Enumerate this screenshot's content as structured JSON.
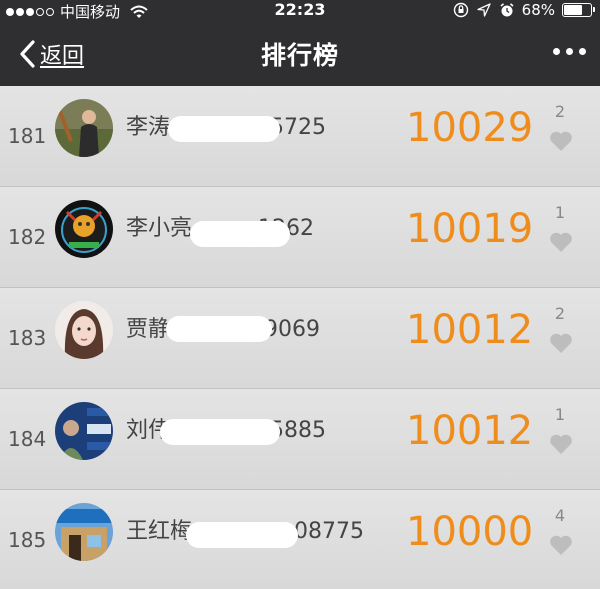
{
  "status_bar": {
    "carrier": "中国移动",
    "time": "22:23",
    "battery": "68%",
    "battery_level": 0.68,
    "signal_bars_filled": 3,
    "signal_bars_total": 5
  },
  "nav": {
    "back_label": "返回",
    "title": "排行榜"
  },
  "colors": {
    "header_bg": "#2f2f31",
    "score": "#ef8d1c",
    "row_bg": "#dedede",
    "heart": "#bdbdbd"
  },
  "ranking": [
    {
      "rank": "181",
      "name": "李涛",
      "phone_tail": "5725",
      "score": "10029",
      "likes": "2"
    },
    {
      "rank": "182",
      "name": "李小亮",
      "phone_tail": "1262",
      "score": "10019",
      "likes": "1"
    },
    {
      "rank": "183",
      "name": "贾静",
      "phone_tail": "39069",
      "score": "10012",
      "likes": "2"
    },
    {
      "rank": "184",
      "name": "刘伟",
      "phone_tail": "5885",
      "score": "10012",
      "likes": "1"
    },
    {
      "rank": "185",
      "name": "王红梅",
      "phone_tail": "08775",
      "score": "10000",
      "likes": "4"
    }
  ]
}
